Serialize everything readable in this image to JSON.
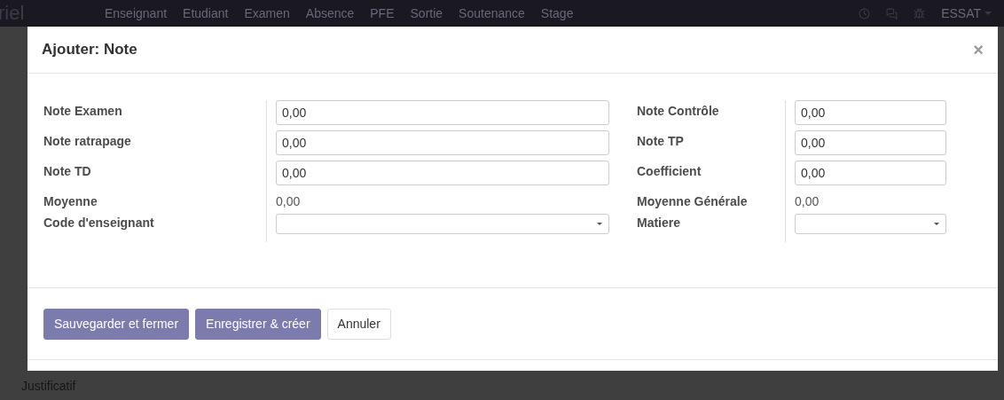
{
  "navbar": {
    "brand": "riel",
    "menu": [
      "Enseignant",
      "Etudiant",
      "Examen",
      "Absence",
      "PFE",
      "Sortie",
      "Soutenance",
      "Stage"
    ],
    "user": "ESSAT"
  },
  "background": {
    "label": "Justificatif"
  },
  "modal": {
    "title": "Ajouter: Note",
    "close": "×",
    "columns": [
      {
        "fields": [
          {
            "label": "Note Examen",
            "kind": "input",
            "value": "0,00"
          },
          {
            "label": "Note ratrapage",
            "kind": "input",
            "value": "0,00"
          },
          {
            "label": "Note TD",
            "kind": "input",
            "value": "0,00"
          },
          {
            "label": "Moyenne",
            "kind": "readonly",
            "value": "0,00"
          },
          {
            "label": "Code d'enseignant",
            "kind": "select"
          }
        ]
      },
      {
        "fields": [
          {
            "label": "Note Contrôle",
            "kind": "input",
            "value": "0,00"
          },
          {
            "label": "Note TP",
            "kind": "input",
            "value": "0,00"
          },
          {
            "label": "Coefficient",
            "kind": "input",
            "value": "0,00"
          },
          {
            "label": "Moyenne Générale",
            "kind": "readonly",
            "value": "0,00"
          },
          {
            "label": "Matiere",
            "kind": "select"
          }
        ]
      }
    ],
    "buttons": [
      {
        "label": "Sauvegarder et fermer",
        "kind": "primary"
      },
      {
        "label": "Enregistrer & créer",
        "kind": "primary"
      },
      {
        "label": "Annuler",
        "kind": "secondary"
      }
    ]
  }
}
